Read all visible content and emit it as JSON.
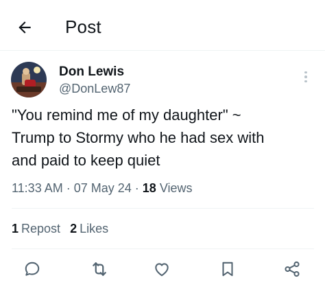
{
  "header": {
    "title": "Post",
    "back_icon": "arrow-left-icon"
  },
  "author": {
    "name": "Don Lewis",
    "handle": "@DonLew87",
    "more_icon": "more-vertical-icon"
  },
  "tweet": {
    "text": "\"You remind me of my daughter\" ~\nTrump to Stormy who he had sex with\nand paid to keep quiet"
  },
  "meta": {
    "time": "11:33 AM",
    "date": "07 May 24",
    "views_count": "18",
    "views_label": "Views"
  },
  "stats": {
    "reposts_count": "1",
    "reposts_label": "Repost",
    "likes_count": "2",
    "likes_label": "Likes"
  },
  "actions": [
    "reply-icon",
    "repost-icon",
    "like-icon",
    "bookmark-icon",
    "share-icon"
  ],
  "colors": {
    "text": "#0f1419",
    "secondary": "#536471",
    "divider": "#eff3f4"
  }
}
